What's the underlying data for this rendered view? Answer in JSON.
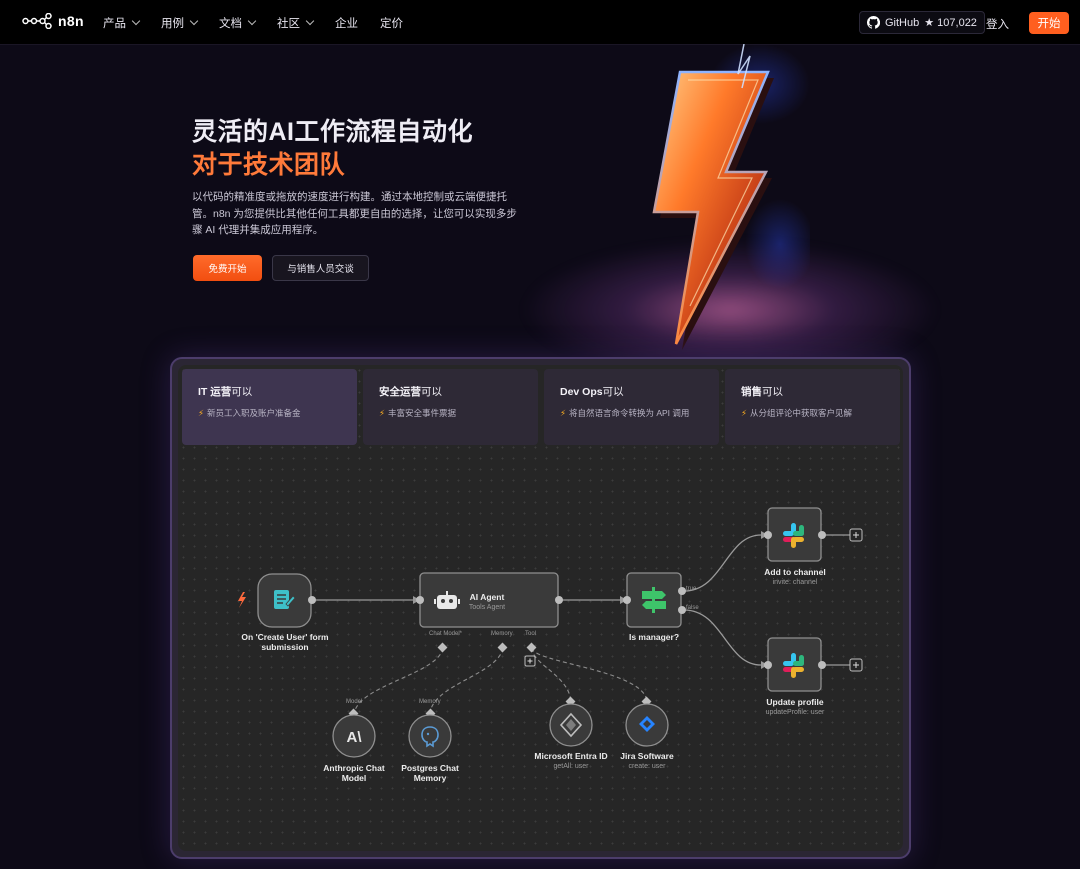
{
  "nav": {
    "logo": "n8n",
    "items": [
      {
        "label": "产品",
        "dropdown": true
      },
      {
        "label": "用例",
        "dropdown": true
      },
      {
        "label": "文档",
        "dropdown": true
      },
      {
        "label": "社区",
        "dropdown": true
      },
      {
        "label": "企业",
        "dropdown": false
      },
      {
        "label": "定价",
        "dropdown": false
      }
    ],
    "github_label": "GitHub",
    "github_stars": "★ 107,022",
    "login": "登入",
    "start": "开始"
  },
  "hero": {
    "title_line1": "灵活的AI工作流程自动化",
    "title_line2": "对于技术团队",
    "description": "以代码的精准度或拖放的速度进行构建。通过本地控制或云端便捷托管。n8n 为您提供比其他任何工具都更自由的选择，让您可以实现多步骤 AI 代理并集成应用程序。",
    "primary_button": "免费开始",
    "secondary_button": "与销售人员交谈"
  },
  "tabs": [
    {
      "title_bold": "IT 运营",
      "title_rest": "可以",
      "desc": "新员工入职及账户准备金",
      "active": true
    },
    {
      "title_bold": "安全运营",
      "title_rest": "可以",
      "desc": "丰富安全事件票据",
      "active": false
    },
    {
      "title_bold": "Dev Ops",
      "title_rest": "可以",
      "desc": "将自然语言命令转换为 API 调用",
      "active": false
    },
    {
      "title_bold": "销售",
      "title_rest": "可以",
      "desc": "从分组评论中获取客户见解",
      "active": false
    }
  ],
  "workflow": {
    "trigger": {
      "label": "On 'Create User' form submission",
      "icon": "form-icon"
    },
    "agent": {
      "label": "AI Agent",
      "sub": "Tools Agent",
      "ports": [
        "Chat Model*",
        "Memory",
        "Tool"
      ],
      "icon": "robot-icon"
    },
    "router": {
      "label": "Is manager?",
      "branches": [
        "true",
        "false"
      ],
      "icon": "signpost-icon"
    },
    "slack_top": {
      "label": "Add to channel",
      "sub": "invite: channel",
      "icon": "slack-icon"
    },
    "slack_bottom": {
      "label": "Update profile",
      "sub": "updateProfile: user",
      "icon": "slack-icon"
    },
    "model": {
      "port": "Model",
      "label": "Anthropic Chat Model",
      "icon": "anthropic-icon"
    },
    "memory": {
      "port": "Memory",
      "label": "Postgres Chat Memory",
      "icon": "postgres-icon"
    },
    "entra": {
      "label": "Microsoft Entra ID",
      "sub": "getAll: user",
      "icon": "entra-icon"
    },
    "jira": {
      "label": "Jira Software",
      "sub": "create: user",
      "icon": "jira-icon"
    }
  },
  "colors": {
    "accent": "#ff5f1f",
    "accent_text": "#ff7a3a",
    "background": "#0d0a17",
    "canvas": "#262626"
  }
}
